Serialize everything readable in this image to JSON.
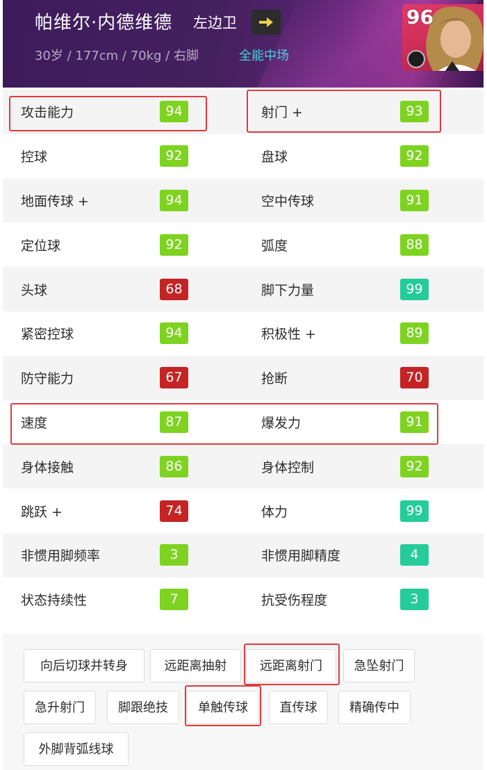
{
  "header": {
    "name": "帕维尔·内德维德",
    "position": "左边卫",
    "info": "30岁 / 177cm / 70kg / 右脚",
    "role": "全能中场",
    "overall": "96",
    "arrow_icon": "arrow-right-icon"
  },
  "colors": {
    "green": "#7ed321",
    "teal": "#25cc9a",
    "red": "#c42424",
    "highlight": "#e2383d",
    "role_text": "#46d3dc"
  },
  "stats": [
    {
      "left": {
        "label": "攻击能力",
        "value": "94",
        "color": "green"
      },
      "right": {
        "label": "射门 +",
        "value": "93",
        "color": "green"
      }
    },
    {
      "left": {
        "label": "控球",
        "value": "92",
        "color": "green"
      },
      "right": {
        "label": "盘球",
        "value": "92",
        "color": "green"
      }
    },
    {
      "left": {
        "label": "地面传球 +",
        "value": "94",
        "color": "green"
      },
      "right": {
        "label": "空中传球",
        "value": "91",
        "color": "green"
      }
    },
    {
      "left": {
        "label": "定位球",
        "value": "92",
        "color": "green"
      },
      "right": {
        "label": "弧度",
        "value": "88",
        "color": "green"
      }
    },
    {
      "left": {
        "label": "头球",
        "value": "68",
        "color": "red"
      },
      "right": {
        "label": "脚下力量",
        "value": "99",
        "color": "teal"
      }
    },
    {
      "left": {
        "label": "紧密控球",
        "value": "94",
        "color": "green"
      },
      "right": {
        "label": "积极性 +",
        "value": "89",
        "color": "green"
      }
    },
    {
      "left": {
        "label": "防守能力",
        "value": "67",
        "color": "red"
      },
      "right": {
        "label": "抢断",
        "value": "70",
        "color": "red"
      }
    },
    {
      "left": {
        "label": "速度",
        "value": "87",
        "color": "green"
      },
      "right": {
        "label": "爆发力",
        "value": "91",
        "color": "green"
      }
    },
    {
      "left": {
        "label": "身体接触",
        "value": "86",
        "color": "green"
      },
      "right": {
        "label": "身体控制",
        "value": "92",
        "color": "green"
      }
    },
    {
      "left": {
        "label": "跳跃 +",
        "value": "74",
        "color": "red"
      },
      "right": {
        "label": "体力",
        "value": "99",
        "color": "teal"
      }
    },
    {
      "left": {
        "label": "非惯用脚频率",
        "value": "3",
        "color": "green"
      },
      "right": {
        "label": "非惯用脚精度",
        "value": "4",
        "color": "teal"
      }
    },
    {
      "left": {
        "label": "状态持续性",
        "value": "7",
        "color": "green"
      },
      "right": {
        "label": "抗受伤程度",
        "value": "3",
        "color": "teal"
      }
    }
  ],
  "skills": [
    "向后切球并转身",
    "远距离抽射",
    "远距离射门",
    "急坠射门",
    "急升射门",
    "脚跟绝技",
    "单触传球",
    "直传球",
    "精确传中",
    "外脚背弧线球"
  ]
}
